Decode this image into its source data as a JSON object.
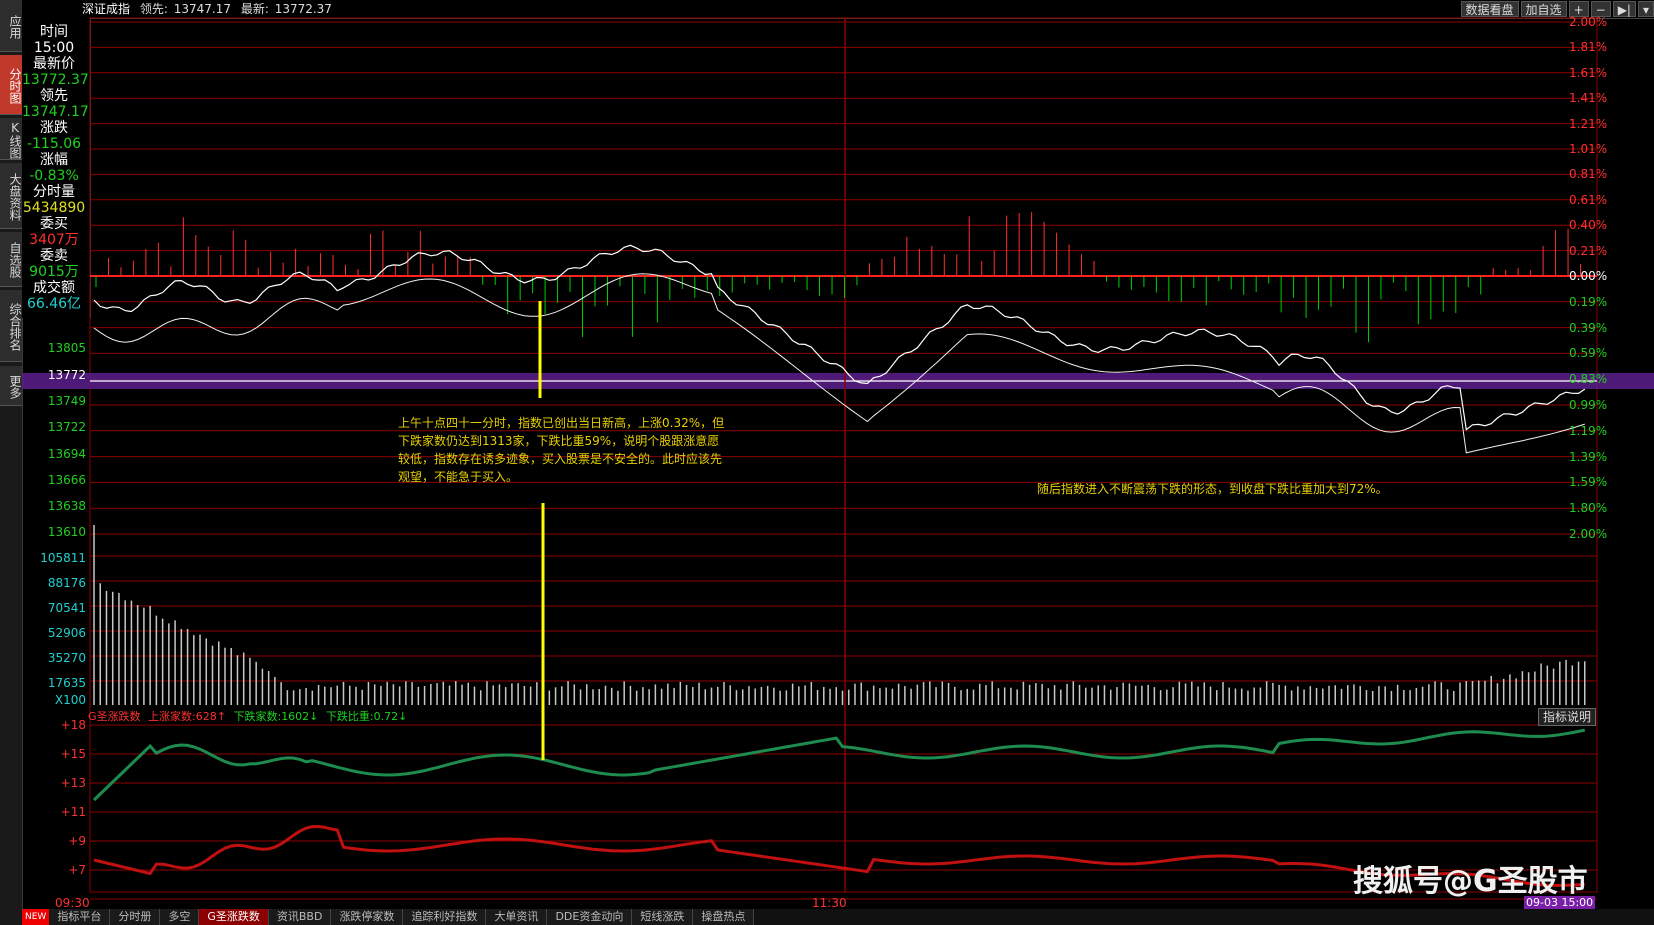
{
  "title_bar": {
    "index_name": "深证成指",
    "lead_label": "领先:",
    "lead_value": "13747.17",
    "last_label": "最新:",
    "last_value": "13772.37",
    "btn_data": "数据看盘",
    "btn_add": "加自选",
    "btn_plus": "+",
    "btn_minus": "−",
    "btn_next": "▶|",
    "btn_menu": "▾"
  },
  "left_tabs": [
    {
      "label": "应用",
      "active": false
    },
    {
      "label": "分时图",
      "active": true
    },
    {
      "label": "K线图",
      "active": false
    },
    {
      "label": "大盘资料",
      "active": false
    },
    {
      "label": "自选股",
      "active": false
    },
    {
      "label": "综合排名",
      "active": false
    },
    {
      "label": "更多",
      "active": false
    }
  ],
  "info": {
    "time_label": "时间",
    "time_value": "15:00",
    "last_label": "最新价",
    "last_value": "13772.37",
    "lead_label": "领先",
    "lead_value": "13747.17",
    "change_label": "涨跌",
    "change_value": "-115.06",
    "pct_label": "涨幅",
    "pct_value": "-0.83%",
    "vol_label": "分时量",
    "vol_value": "5434890",
    "bid_label": "委买",
    "bid_value": "3407万",
    "ask_label": "委卖",
    "ask_value": "9015万",
    "amount_label": "成交额",
    "amount_value": "66.46亿"
  },
  "price_axis_left": [
    "13805",
    "13772",
    "13749",
    "13722",
    "13694",
    "13666",
    "13638",
    "13610"
  ],
  "price_axis_right_up": [
    "2.00%",
    "1.81%",
    "1.61%",
    "1.41%",
    "1.21%",
    "1.01%",
    "0.81%",
    "0.61%",
    "0.40%",
    "0.21%",
    "0.00%"
  ],
  "price_axis_right_down": [
    "0.19%",
    "0.39%",
    "0.59%",
    "0.83%",
    "0.99%",
    "1.19%",
    "1.39%",
    "1.59%",
    "1.80%",
    "2.00%"
  ],
  "volume_axis": [
    "105811",
    "88176",
    "70541",
    "52906",
    "35270",
    "17635",
    "X100"
  ],
  "adl_axis": [
    "+18",
    "+15",
    "+13",
    "+11",
    "+9",
    "+7"
  ],
  "adl_header": {
    "name": "G圣涨跌数",
    "up_label": "上涨家数:",
    "up_value": "628↑",
    "down_label": "下跌家数:",
    "down_value": "1602↓",
    "ratio_label": "下跌比重:",
    "ratio_value": "0.72↓",
    "explain_btn": "指标说明"
  },
  "time_axis": {
    "start": "09:30",
    "mid": "11:30",
    "end_badge": "09-03 15:00"
  },
  "annotations": {
    "left": "上午十点四十一分时，指数已创出当日新高，上涨0.32%，但下跌家数仍达到1313家，下跌比重59%，说明个股跟涨意愿较低，指数存在诱多迹象，买入股票是不安全的。此时应该先观望，不能急于买入。",
    "right": "随后指数进入不断震荡下跌的形态，到收盘下跌比重加大到72%。"
  },
  "watermark": "搜狐号@G圣股市",
  "bottom_tabs": {
    "new_badge": "NEW",
    "items": [
      {
        "label": "指标平台",
        "active": false
      },
      {
        "label": "分时册",
        "active": false
      },
      {
        "label": "多空",
        "active": false
      },
      {
        "label": "G圣涨跌数",
        "active": true
      },
      {
        "label": "资讯BBD",
        "active": false
      },
      {
        "label": "涨跌停家数",
        "active": false
      },
      {
        "label": "追踪利好指数",
        "active": false
      },
      {
        "label": "大单资讯",
        "active": false
      },
      {
        "label": "DDE资金动向",
        "active": false
      },
      {
        "label": "短线涨跌",
        "active": false
      },
      {
        "label": "操盘热点",
        "active": false
      }
    ]
  },
  "colors": {
    "up": "#ff3030",
    "down": "#00d000",
    "grid": "#8b0000",
    "price_line": "#ffffff",
    "volume": "#c8c8c8",
    "adl_up": "#1e8b4f",
    "adl_down": "#c01010",
    "marker": "#ffff00",
    "highlight_row": "#5a1e8c"
  }
}
